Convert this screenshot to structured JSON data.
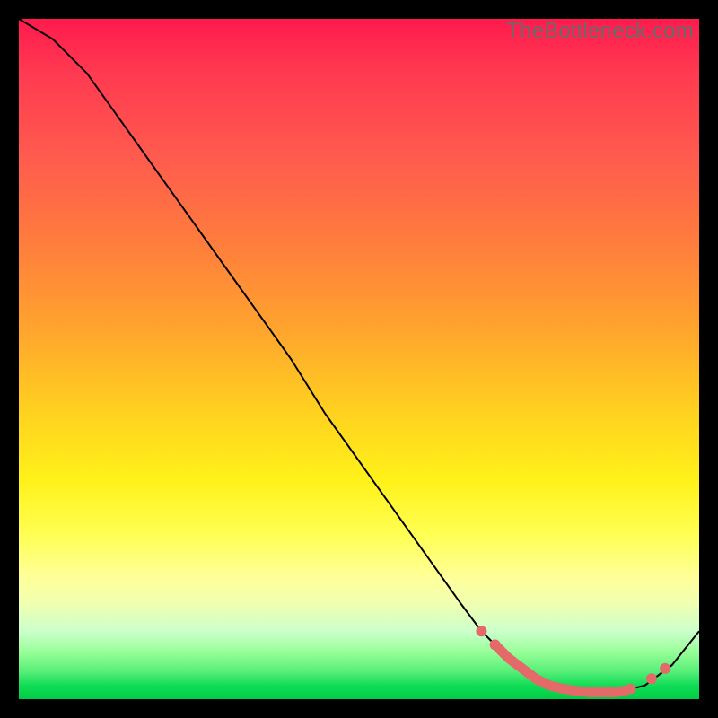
{
  "watermark": "TheBottleneck.com",
  "colors": {
    "dot": "#e46a6a",
    "curve": "#000000"
  },
  "chart_data": {
    "type": "line",
    "title": "",
    "xlabel": "",
    "ylabel": "",
    "xlim": [
      0,
      100
    ],
    "ylim": [
      0,
      100
    ],
    "grid": false,
    "series": [
      {
        "name": "bottleneck-curve",
        "x": [
          0,
          5,
          10,
          15,
          20,
          25,
          30,
          35,
          40,
          45,
          50,
          55,
          60,
          65,
          68,
          72,
          76,
          80,
          84,
          88,
          92,
          96,
          100
        ],
        "y": [
          100,
          97,
          92,
          85,
          78,
          71,
          64,
          57,
          50,
          42,
          35,
          28,
          21,
          14,
          10,
          6,
          3,
          1.5,
          1,
          1,
          2,
          5,
          10
        ]
      }
    ],
    "highlight_points": {
      "name": "highlighted-range",
      "x": [
        68,
        70,
        72,
        74,
        76,
        78,
        80,
        82,
        84,
        86,
        88,
        90,
        93,
        95
      ],
      "y": [
        10,
        8,
        6,
        4.5,
        3,
        2,
        1.5,
        1.2,
        1,
        1,
        1,
        1.5,
        3,
        4.5
      ]
    }
  }
}
